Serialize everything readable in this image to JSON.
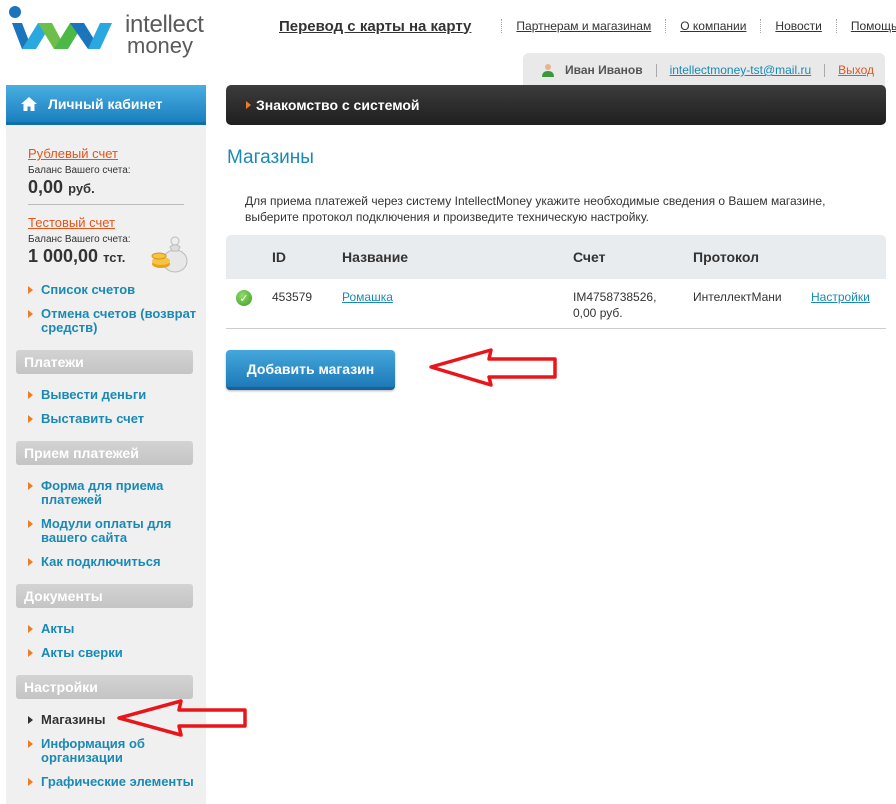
{
  "logo": {
    "word1": "intellect",
    "word2": "money"
  },
  "topnav": [
    {
      "label": "Перевод с карты на карту"
    },
    {
      "label": "Партнерам и магазинам"
    },
    {
      "label": "О компании"
    },
    {
      "label": "Новости"
    },
    {
      "label": "Помощь"
    }
  ],
  "user": {
    "name": "Иван Иванов",
    "email": "intellectmoney-tst@mail.ru",
    "logout": "Выход"
  },
  "sidebar": {
    "title": "Личный кабинет",
    "accounts": [
      {
        "name": "Рублевый счет",
        "balance_label": "Баланс Вашего счета:",
        "amount": "0,00",
        "currency": "руб."
      },
      {
        "name": "Тестовый счет",
        "balance_label": "Баланс Вашего счета:",
        "amount": "1 000,00",
        "currency": "тст."
      }
    ],
    "top_links": [
      "Список счетов",
      "Отмена счетов (возврат средств)"
    ],
    "sections": [
      {
        "title": "Платежи",
        "items": [
          "Вывести деньги",
          "Выставить счет"
        ]
      },
      {
        "title": "Прием платежей",
        "items": [
          "Форма для приема платежей",
          "Модули оплаты для вашего сайта",
          "Как подключиться"
        ]
      },
      {
        "title": "Документы",
        "items": [
          "Акты",
          "Акты сверки"
        ]
      },
      {
        "title": "Настройки",
        "items": [
          "Магазины",
          "Информация об организации",
          "Графические элементы"
        ]
      }
    ]
  },
  "main": {
    "bar_label": "Знакомство с системой",
    "title": "Магазины",
    "intro": "Для приема платежей через систему IntellectMoney укажите необходимые сведения о Вашем магазине, выберите протокол подключения и произведите техническую настройку.",
    "table": {
      "headers": [
        "ID",
        "Название",
        "Счет",
        "Протокол"
      ],
      "rows": [
        {
          "id": "453579",
          "name": "Ромашка",
          "account": "IM4758738526,",
          "account_balance": "0,00 руб.",
          "protocol": "ИнтеллектМани",
          "action": "Настройки"
        }
      ]
    },
    "add_button": "Добавить магазин"
  },
  "colors": {
    "accent": "#1a8ab5",
    "orange": "#e4541b",
    "arrow": "#e8161b"
  }
}
